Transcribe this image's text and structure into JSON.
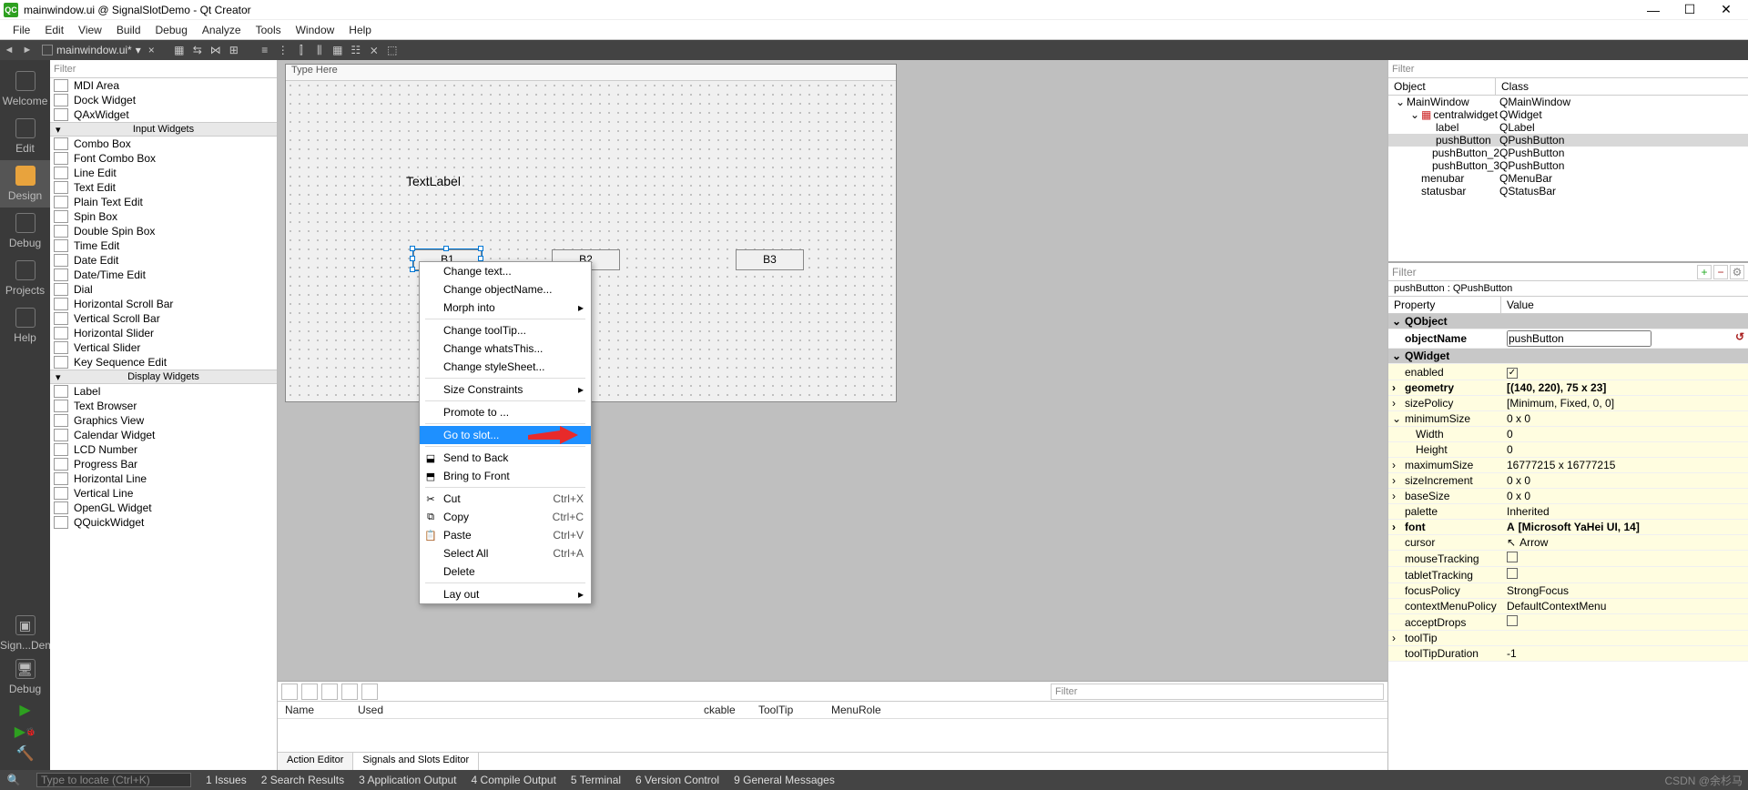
{
  "title": "mainwindow.ui @ SignalSlotDemo - Qt Creator",
  "app_icon_text": "QC",
  "menus": [
    "File",
    "Edit",
    "View",
    "Build",
    "Debug",
    "Analyze",
    "Tools",
    "Window",
    "Help"
  ],
  "doc_tab": {
    "name": "mainwindow.ui*"
  },
  "modes": [
    {
      "id": "welcome",
      "label": "Welcome"
    },
    {
      "id": "edit",
      "label": "Edit"
    },
    {
      "id": "design",
      "label": "Design",
      "active": true
    },
    {
      "id": "debug",
      "label": "Debug"
    },
    {
      "id": "projects",
      "label": "Projects"
    },
    {
      "id": "help",
      "label": "Help"
    }
  ],
  "mode_bottom_project": "Sign...Demo",
  "mode_bottom_debug": "Debug",
  "widgetbox": {
    "filter": "Filter",
    "top_items": [
      "MDI Area",
      "Dock Widget",
      "QAxWidget"
    ],
    "input_cat": "Input Widgets",
    "input_items": [
      "Combo Box",
      "Font Combo Box",
      "Line Edit",
      "Text Edit",
      "Plain Text Edit",
      "Spin Box",
      "Double Spin Box",
      "Time Edit",
      "Date Edit",
      "Date/Time Edit",
      "Dial",
      "Horizontal Scroll Bar",
      "Vertical Scroll Bar",
      "Horizontal Slider",
      "Vertical Slider",
      "Key Sequence Edit"
    ],
    "display_cat": "Display Widgets",
    "display_items": [
      "Label",
      "Text Browser",
      "Graphics View",
      "Calendar Widget",
      "LCD Number",
      "Progress Bar",
      "Horizontal Line",
      "Vertical Line",
      "OpenGL Widget",
      "QQuickWidget"
    ]
  },
  "form": {
    "type_here": "Type Here",
    "text_label": "TextLabel",
    "b1": "B1",
    "b2": "B2",
    "b3": "B3"
  },
  "context_menu": {
    "items": [
      {
        "t": "Change text..."
      },
      {
        "t": "Change objectName..."
      },
      {
        "t": "Morph into",
        "sub": true
      },
      {
        "sep": true
      },
      {
        "t": "Change toolTip..."
      },
      {
        "t": "Change whatsThis..."
      },
      {
        "t": "Change styleSheet..."
      },
      {
        "sep": true
      },
      {
        "t": "Size Constraints",
        "sub": true
      },
      {
        "sep": true
      },
      {
        "t": "Promote to ..."
      },
      {
        "sep": true
      },
      {
        "t": "Go to slot...",
        "hl": true
      },
      {
        "sep": true
      },
      {
        "t": "Send to Back",
        "ico": "⬓"
      },
      {
        "t": "Bring to Front",
        "ico": "⬒"
      },
      {
        "sep": true
      },
      {
        "t": "Cut",
        "sc": "Ctrl+X",
        "ico": "✂"
      },
      {
        "t": "Copy",
        "sc": "Ctrl+C",
        "ico": "⧉"
      },
      {
        "t": "Paste",
        "sc": "Ctrl+V",
        "ico": "📋"
      },
      {
        "t": "Select All",
        "sc": "Ctrl+A"
      },
      {
        "t": "Delete"
      },
      {
        "sep": true
      },
      {
        "t": "Lay out",
        "sub": true
      }
    ]
  },
  "action_panel": {
    "filter": "Filter",
    "columns": [
      "Name",
      "Used",
      "",
      "",
      "ckable",
      "ToolTip",
      "MenuRole"
    ],
    "tabs": [
      "Action Editor",
      "Signals and Slots Editor"
    ]
  },
  "obj_inspector": {
    "filter": "Filter",
    "columns": [
      "Object",
      "Class"
    ],
    "rows": [
      {
        "name": "MainWindow",
        "cls": "QMainWindow",
        "ind": 0,
        "exp": "v"
      },
      {
        "name": "centralwidget",
        "cls": "QWidget",
        "ind": 1,
        "exp": "v",
        "ico": true
      },
      {
        "name": "label",
        "cls": "QLabel",
        "ind": 2
      },
      {
        "name": "pushButton",
        "cls": "QPushButton",
        "ind": 2,
        "sel": true
      },
      {
        "name": "pushButton_2",
        "cls": "QPushButton",
        "ind": 2
      },
      {
        "name": "pushButton_3",
        "cls": "QPushButton",
        "ind": 2
      },
      {
        "name": "menubar",
        "cls": "QMenuBar",
        "ind": 1
      },
      {
        "name": "statusbar",
        "cls": "QStatusBar",
        "ind": 1
      }
    ]
  },
  "prop": {
    "filter": "Filter",
    "title": "pushButton : QPushButton",
    "columns": [
      "Property",
      "Value"
    ],
    "rows": [
      {
        "k": "QObject",
        "group": true,
        "exp": "v"
      },
      {
        "k": "objectName",
        "v": "pushButton",
        "bold": true,
        "input": true
      },
      {
        "k": "QWidget",
        "group": true,
        "yellow": true,
        "exp": "v"
      },
      {
        "k": "enabled",
        "v": "",
        "chk": true,
        "checked": true,
        "yellow": true
      },
      {
        "k": "geometry",
        "v": "[(140, 220), 75 x 23]",
        "yellow": true,
        "exp": ">",
        "bold": true
      },
      {
        "k": "sizePolicy",
        "v": "[Minimum, Fixed, 0, 0]",
        "yellow": true,
        "exp": ">"
      },
      {
        "k": "minimumSize",
        "v": "0 x 0",
        "yellow": true,
        "exp": "v"
      },
      {
        "k": "Width",
        "v": "0",
        "yellow": true,
        "h2": true
      },
      {
        "k": "Height",
        "v": "0",
        "yellow": true,
        "h2": true
      },
      {
        "k": "maximumSize",
        "v": "16777215 x 16777215",
        "yellow": true,
        "exp": ">"
      },
      {
        "k": "sizeIncrement",
        "v": "0 x 0",
        "yellow": true,
        "exp": ">"
      },
      {
        "k": "baseSize",
        "v": "0 x 0",
        "yellow": true,
        "exp": ">"
      },
      {
        "k": "palette",
        "v": "Inherited",
        "yellow": true
      },
      {
        "k": "font",
        "v": "[Microsoft YaHei UI, 14]",
        "yellow": true,
        "exp": ">",
        "bold": true,
        "pre": "A"
      },
      {
        "k": "cursor",
        "v": "Arrow",
        "yellow": true,
        "pre": "↖"
      },
      {
        "k": "mouseTracking",
        "v": "",
        "chk": true,
        "yellow": true
      },
      {
        "k": "tabletTracking",
        "v": "",
        "chk": true,
        "yellow": true
      },
      {
        "k": "focusPolicy",
        "v": "StrongFocus",
        "yellow": true
      },
      {
        "k": "contextMenuPolicy",
        "v": "DefaultContextMenu",
        "yellow": true
      },
      {
        "k": "acceptDrops",
        "v": "",
        "chk": true,
        "yellow": true
      },
      {
        "k": "toolTip",
        "v": "",
        "yellow": true,
        "exp": ">"
      },
      {
        "k": "toolTipDuration",
        "v": "-1",
        "yellow": true
      }
    ]
  },
  "status": {
    "search_placeholder": "Type to locate (Ctrl+K)",
    "items": [
      "1  Issues",
      "2  Search Results",
      "3  Application Output",
      "4  Compile Output",
      "5  Terminal",
      "6  Version Control",
      "9  General Messages"
    ],
    "watermark": "CSDN @余杉马"
  }
}
